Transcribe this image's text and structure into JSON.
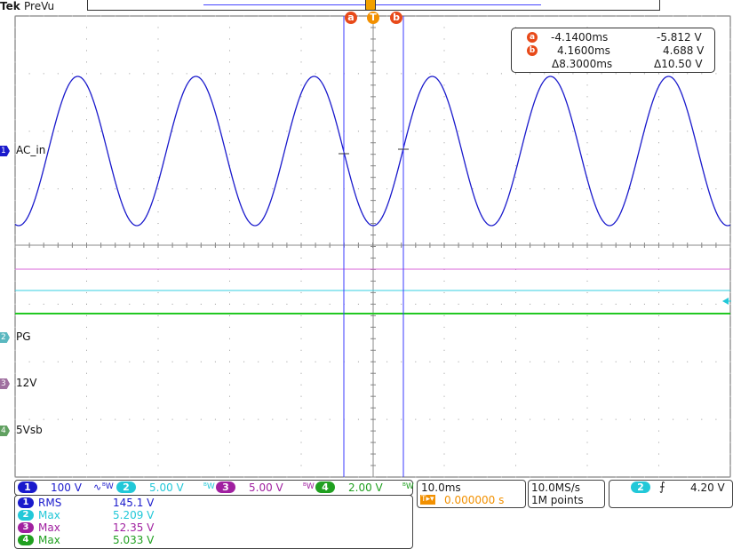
{
  "header": {
    "brand": "Tek",
    "mode": "PreVu",
    "trigger_marker": "T",
    "cursor_a_marker": "a",
    "cursor_b_marker": "b"
  },
  "cursor_readout": {
    "a_time": "-4.1400ms",
    "a_value": "-5.812 V",
    "b_time": "4.1600ms",
    "b_value": "4.688 V",
    "delta_time": "Δ8.3000ms",
    "delta_value": "Δ10.50 V"
  },
  "channels": [
    {
      "num": "1",
      "name": "AC_in",
      "color": "#1a1acc",
      "scale": "100 V"
    },
    {
      "num": "2",
      "name": "PG",
      "color": "#22c8d8",
      "scale": "5.00 V"
    },
    {
      "num": "3",
      "name": "12V",
      "color": "#a020a0",
      "scale": "5.00 V"
    },
    {
      "num": "4",
      "name": "5Vsb",
      "color": "#20a020",
      "scale": "2.00 V"
    }
  ],
  "channel_scale_suffix": "ᴮW",
  "channel1_coupling_icon": "∿",
  "measurements": [
    {
      "num": "1",
      "label": "RMS",
      "value": "145.1 V",
      "color": "#1a1acc"
    },
    {
      "num": "2",
      "label": "Max",
      "value": "5.209 V",
      "color": "#22c8d8"
    },
    {
      "num": "3",
      "label": "Max",
      "value": "12.35 V",
      "color": "#a020a0"
    },
    {
      "num": "4",
      "label": "Max",
      "value": "5.033 V",
      "color": "#20a020"
    }
  ],
  "timebase": {
    "scale": "10.0ms",
    "position": "0.000000 s",
    "position_prefix": "T▸▾"
  },
  "acquisition": {
    "rate": "10.0MS/s",
    "length": "1M points"
  },
  "trigger": {
    "source": "2",
    "slope_icon": "rising-edge",
    "slope_glyph": "⨍",
    "level": "4.20 V"
  },
  "colors": {
    "grid": "#999999",
    "cursor": "#3a3aff",
    "ch1": "#1a1acc",
    "ch2": "#22c8d8",
    "ch3": "#d040d0",
    "ch4": "#20c020",
    "trigger_orange": "#f29000",
    "cursor_badge": "#e84a1a"
  }
}
